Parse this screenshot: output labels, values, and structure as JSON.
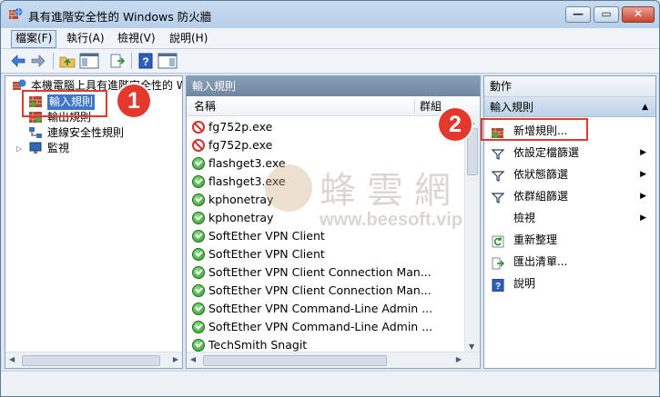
{
  "window": {
    "title": "具有進階安全性的 Windows 防火牆",
    "minimize_glyph": "—",
    "maximize_glyph": "▭",
    "close_glyph": "✕"
  },
  "menu": [
    {
      "label": "檔案(F)"
    },
    {
      "label": "執行(A)"
    },
    {
      "label": "檢視(V)"
    },
    {
      "label": "說明(H)"
    }
  ],
  "toolbar": {
    "icons": [
      "back-arrow-icon",
      "forward-arrow-icon",
      "up-folder-icon",
      "show-hide-tree-icon",
      "export-list-icon",
      "help-icon",
      "show-hide-action-pane-icon"
    ]
  },
  "tree": {
    "root": "本機電腦上具有進階安全性的 W",
    "items": [
      {
        "label": "輸入規則"
      },
      {
        "label": "輸出規則"
      },
      {
        "label": "連線安全性規則"
      },
      {
        "label": "監視"
      }
    ]
  },
  "rules_pane": {
    "header": "輸入規則",
    "columns": [
      "名稱",
      "群組"
    ],
    "rows": [
      {
        "name": "fg752p.exe",
        "status": "block"
      },
      {
        "name": "fg752p.exe",
        "status": "block"
      },
      {
        "name": "flashget3.exe",
        "status": "allow"
      },
      {
        "name": "flashget3.exe",
        "status": "allow"
      },
      {
        "name": "kphonetray",
        "status": "allow"
      },
      {
        "name": "kphonetray",
        "status": "allow"
      },
      {
        "name": "SoftEther VPN Client",
        "status": "allow"
      },
      {
        "name": "SoftEther VPN Client",
        "status": "allow"
      },
      {
        "name": "SoftEther VPN Client Connection Man...",
        "status": "allow"
      },
      {
        "name": "SoftEther VPN Client Connection Man...",
        "status": "allow"
      },
      {
        "name": "SoftEther VPN Command-Line Admin ...",
        "status": "allow"
      },
      {
        "name": "SoftEther VPN Command-Line Admin ...",
        "status": "allow"
      },
      {
        "name": "TechSmith Snagit",
        "status": "allow"
      }
    ]
  },
  "actions_pane": {
    "header": "動作",
    "section": "輸入規則",
    "items": [
      {
        "label": "新增規則...",
        "icon": "new-rule-icon",
        "submenu": false
      },
      {
        "label": "依設定檔篩選",
        "icon": "filter-icon",
        "submenu": true
      },
      {
        "label": "依狀態篩選",
        "icon": "filter-icon",
        "submenu": true
      },
      {
        "label": "依群組篩選",
        "icon": "filter-icon",
        "submenu": true
      },
      {
        "label": "檢視",
        "icon": "",
        "submenu": true
      },
      {
        "label": "重新整理",
        "icon": "refresh-icon",
        "submenu": false
      },
      {
        "label": "匯出清單...",
        "icon": "export-icon",
        "submenu": false
      },
      {
        "label": "說明",
        "icon": "help-icon",
        "submenu": false
      }
    ]
  },
  "callouts": [
    "1",
    "2"
  ],
  "watermark": {
    "text": "蜂雲網",
    "url": "www.beesoft.vip"
  },
  "colors": {
    "callout_red": "#e3382c",
    "pane_header": "#7890aa",
    "allow_green": "#2f9b2a",
    "block_red": "#d2322a"
  }
}
